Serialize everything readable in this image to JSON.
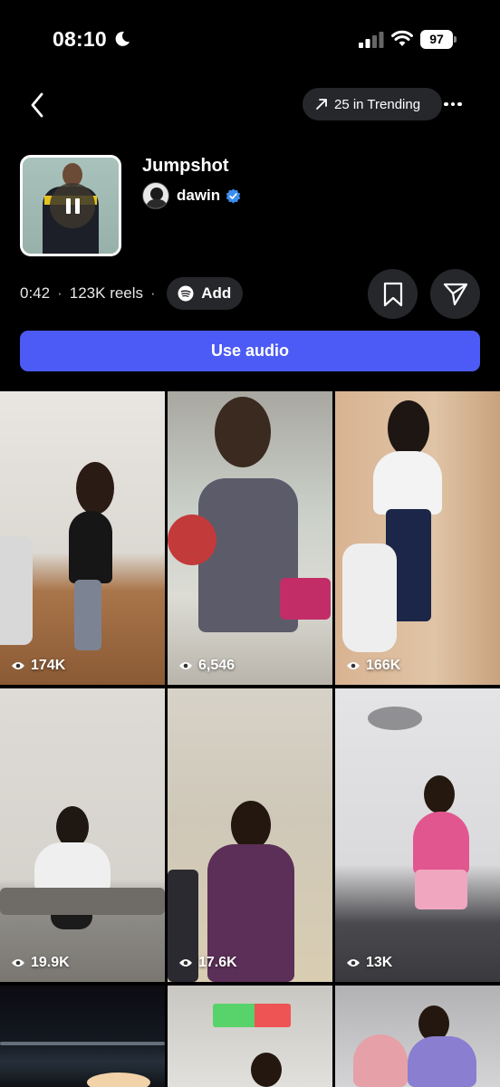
{
  "status_bar": {
    "time": "08:10",
    "battery": "97"
  },
  "header": {
    "trending_label": "25 in Trending"
  },
  "track": {
    "title": "Jumpshot",
    "artist": "dawin",
    "duration": "0:42",
    "reels_count": "123K reels",
    "add_label": "Add"
  },
  "actions": {
    "use_audio_label": "Use audio"
  },
  "reels": [
    {
      "views": "174K"
    },
    {
      "views": "6,546"
    },
    {
      "views": "166K"
    },
    {
      "views": "19.9K"
    },
    {
      "views": "17.6K"
    },
    {
      "views": "13K"
    },
    {
      "views": ""
    },
    {
      "views": ""
    },
    {
      "views": ""
    }
  ],
  "colors": {
    "accent": "#4c5bf5",
    "pill_bg": "#26272b",
    "verified": "#3b8df0",
    "spotify": "#1db954"
  },
  "icons": [
    "moon-icon",
    "signal-icon",
    "wifi-icon",
    "back-chevron-icon",
    "trending-arrow-icon",
    "more-icon",
    "pause-icon",
    "verified-icon",
    "spotify-icon",
    "bookmark-icon",
    "send-icon",
    "eye-icon"
  ]
}
